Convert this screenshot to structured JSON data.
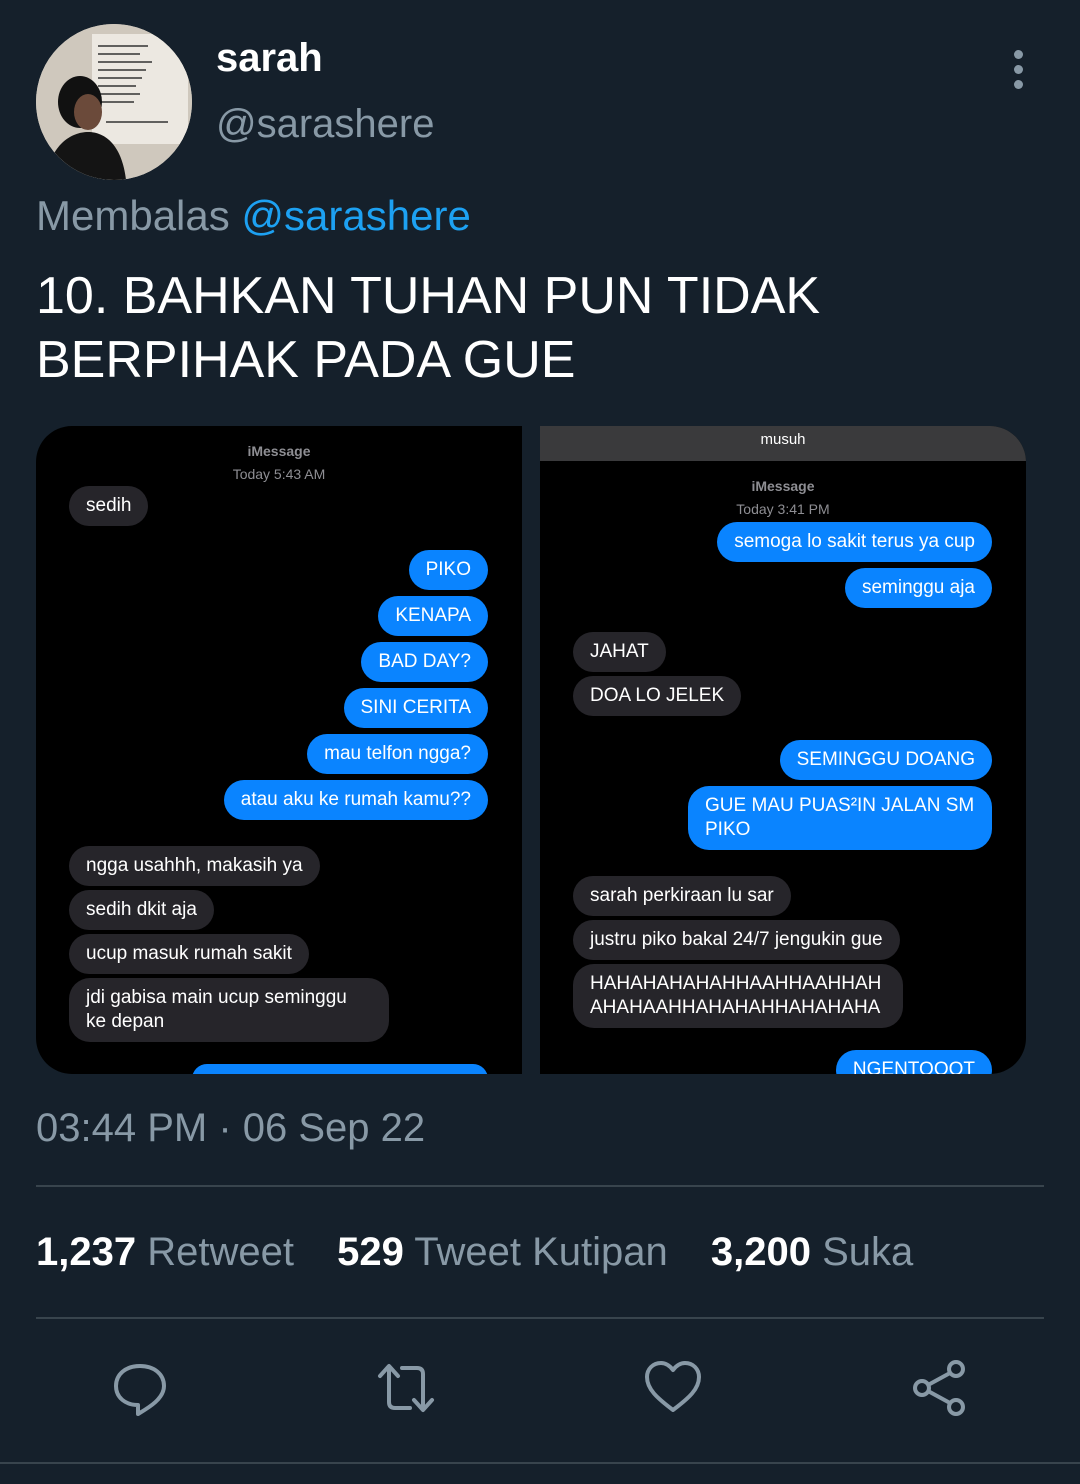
{
  "user": {
    "display_name": "sarah",
    "handle": "@sarashere"
  },
  "reply": {
    "prefix": "Membalas",
    "mention": "@sarashere"
  },
  "tweet": {
    "text_line1": "10. BAHKAN TUHAN PUN TIDAK",
    "text_line2": "BERPIHAK PADA GUE",
    "timestamp": "03:44 PM · 06 Sep 22"
  },
  "screenshot_left": {
    "service": "iMessage",
    "time": "Today 5:43 AM",
    "messages": [
      {
        "dir": "in",
        "text": "sedih"
      },
      {
        "dir": "out",
        "text": "PIKO"
      },
      {
        "dir": "out",
        "text": "KENAPA"
      },
      {
        "dir": "out",
        "text": "BAD DAY?"
      },
      {
        "dir": "out",
        "text": "SINI CERITA"
      },
      {
        "dir": "out",
        "text": "mau telfon ngga?"
      },
      {
        "dir": "out",
        "text": "atau aku ke rumah kamu??"
      },
      {
        "dir": "in",
        "text": "ngga usahhh, makasih ya"
      },
      {
        "dir": "in",
        "text": "sedih dkit aja"
      },
      {
        "dir": "in",
        "text": "ucup masuk rumah sakit"
      },
      {
        "dir": "in",
        "text": "jdi gabisa main ucup seminggu ke depan"
      }
    ]
  },
  "screenshot_right": {
    "contact": "musuh",
    "service": "iMessage",
    "time": "Today 3:41 PM",
    "messages": [
      {
        "dir": "out",
        "text": "semoga lo sakit terus ya cup"
      },
      {
        "dir": "out",
        "text": "seminggu aja"
      },
      {
        "dir": "in",
        "text": "JAHAT"
      },
      {
        "dir": "in",
        "text": "DOA LO JELEK"
      },
      {
        "dir": "out",
        "text": "SEMINGGU DOANG"
      },
      {
        "dir": "out",
        "text": "GUE MAU PUAS²IN JALAN SM PIKO"
      },
      {
        "dir": "in",
        "text": "sarah perkiraan lu sar"
      },
      {
        "dir": "in",
        "text": "justru piko bakal 24/7 jengukin gue"
      },
      {
        "dir": "in",
        "text": "HAHAHAHAHAHHAAHHAAHHAH AHAHAAHHAHAHAHHAHAHAHA"
      },
      {
        "dir": "out",
        "text": "NGENTOOOT"
      }
    ]
  },
  "stats": {
    "retweets": "1,237",
    "retweets_label": "Retweet",
    "quotes": "529",
    "quotes_label": "Tweet Kutipan",
    "likes": "3,200",
    "likes_label": "Suka"
  },
  "icons": {
    "reply": "reply-icon",
    "retweet": "retweet-icon",
    "like": "heart-icon",
    "share": "share-icon",
    "more": "more-vertical-icon"
  },
  "colors": {
    "background": "#15202b",
    "muted": "#8899a6",
    "accent": "#1da1f2",
    "imessage_blue": "#0a84ff",
    "imessage_gray": "#26252a"
  }
}
